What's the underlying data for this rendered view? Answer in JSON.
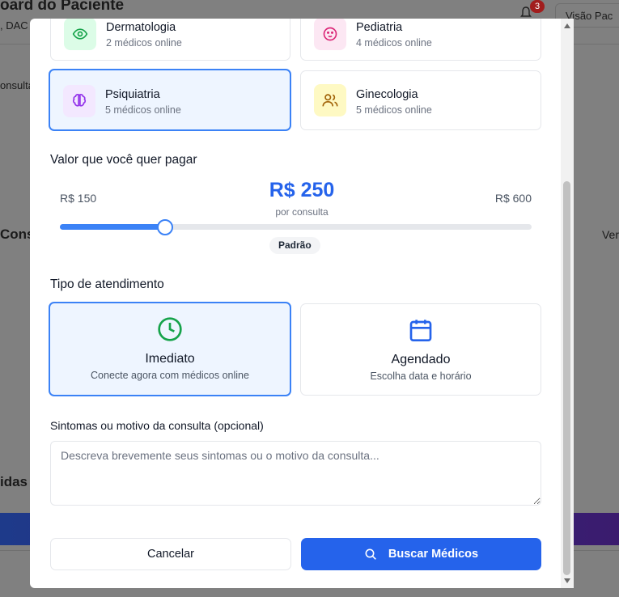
{
  "background": {
    "title_fragment": "oard do Paciente",
    "subtitle_fragment": ", DAC",
    "left_fragment_consulta": "onsulta",
    "left_fragment_cons": "Cons",
    "right_fragment_ver": "Ver",
    "left_fragment_idas": "idas",
    "notification_count": "3",
    "header_button_fragment": "Visão Pac"
  },
  "specialties": [
    {
      "name": "Dermatologia",
      "status": "2 médicos online",
      "icon": "eye-icon",
      "color": "#16a34a",
      "bg": "#dcfce7"
    },
    {
      "name": "Pediatria",
      "status": "4 médicos online",
      "icon": "baby-icon",
      "color": "#db2777",
      "bg": "#fce7f3"
    },
    {
      "name": "Psiquiatria",
      "status": "5 médicos online",
      "icon": "brain-icon",
      "color": "#9333ea",
      "bg": "#f3e8ff",
      "selected": true
    },
    {
      "name": "Ginecologia",
      "status": "5 médicos online",
      "icon": "users-icon",
      "color": "#a16207",
      "bg": "#fef9c3"
    }
  ],
  "price": {
    "heading": "Valor que você quer pagar",
    "min_label": "R$ 150",
    "max_label": "R$ 600",
    "value_label": "R$ 250",
    "per_label": "por consulta",
    "tier_label": "Padrão",
    "min": 150,
    "max": 600,
    "value": 250
  },
  "attendance": {
    "heading": "Tipo de atendimento",
    "options": [
      {
        "title": "Imediato",
        "desc": "Conecte agora com médicos online",
        "icon": "clock-icon",
        "color": "#16a34a",
        "selected": true
      },
      {
        "title": "Agendado",
        "desc": "Escolha data e horário",
        "icon": "calendar-icon",
        "color": "#2563eb"
      }
    ]
  },
  "symptoms": {
    "label": "Sintomas ou motivo da consulta (opcional)",
    "placeholder": "Descreva brevemente seus sintomas ou o motivo da consulta...",
    "value": ""
  },
  "actions": {
    "cancel_label": "Cancelar",
    "search_label": "Buscar Médicos"
  },
  "colors": {
    "accent": "#2563eb",
    "selected_border": "#3b82f6",
    "selected_bg": "#eef5ff"
  }
}
